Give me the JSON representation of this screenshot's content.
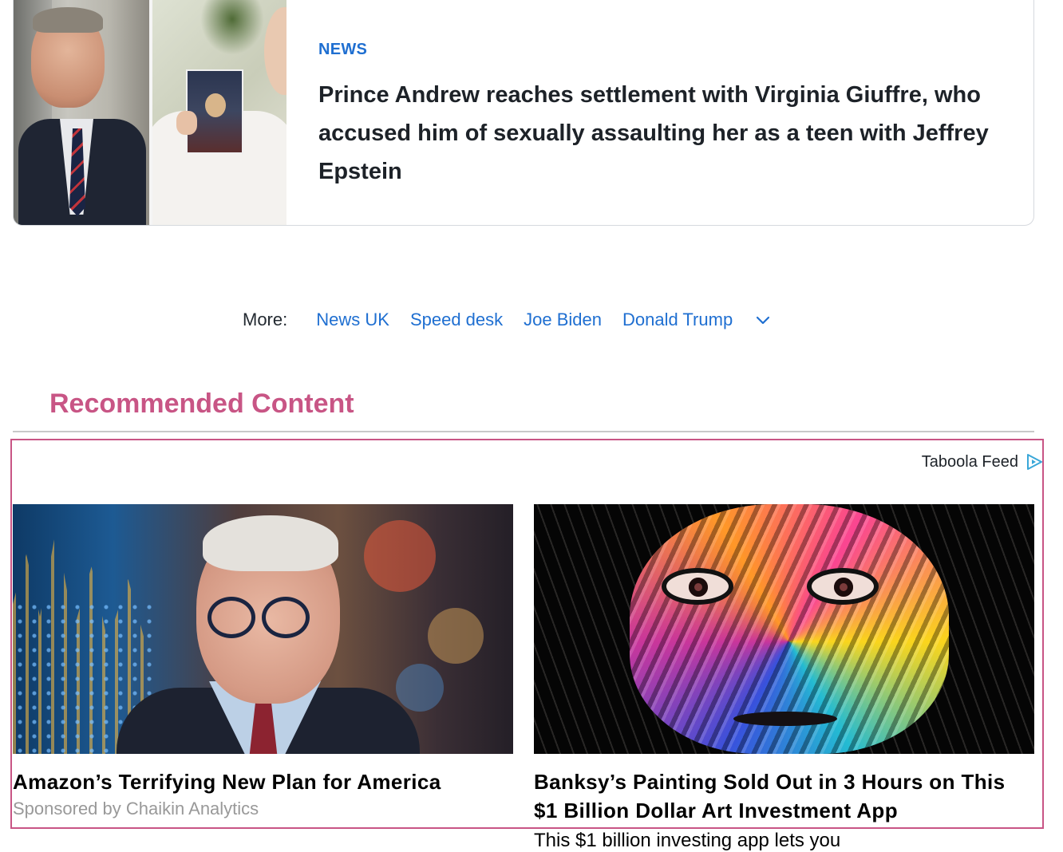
{
  "news_card": {
    "category": "NEWS",
    "headline": "Prince Andrew reaches settlement with Virginia Giuffre, who accused him of sexually assaulting her as a teen with Jeffrey Epstein"
  },
  "more_nav": {
    "label": "More:",
    "links": [
      "News UK",
      "Speed desk",
      "Joe Biden",
      "Donald Trump"
    ]
  },
  "recommended": {
    "title": "Recommended Content",
    "feed_label": "Taboola Feed",
    "items": [
      {
        "title": "Amazon’s Terrifying New Plan for America",
        "sponsor": "Sponsored by Chaikin Analytics"
      },
      {
        "title": "Banksy’s Painting Sold Out in 3 Hours on This $1 Billion Dollar Art Investment App",
        "description": "This $1 billion investing app lets you"
      }
    ]
  },
  "colors": {
    "link": "#1f6fd1",
    "accent": "#c85585",
    "text": "#1d2228",
    "muted": "#999999"
  }
}
